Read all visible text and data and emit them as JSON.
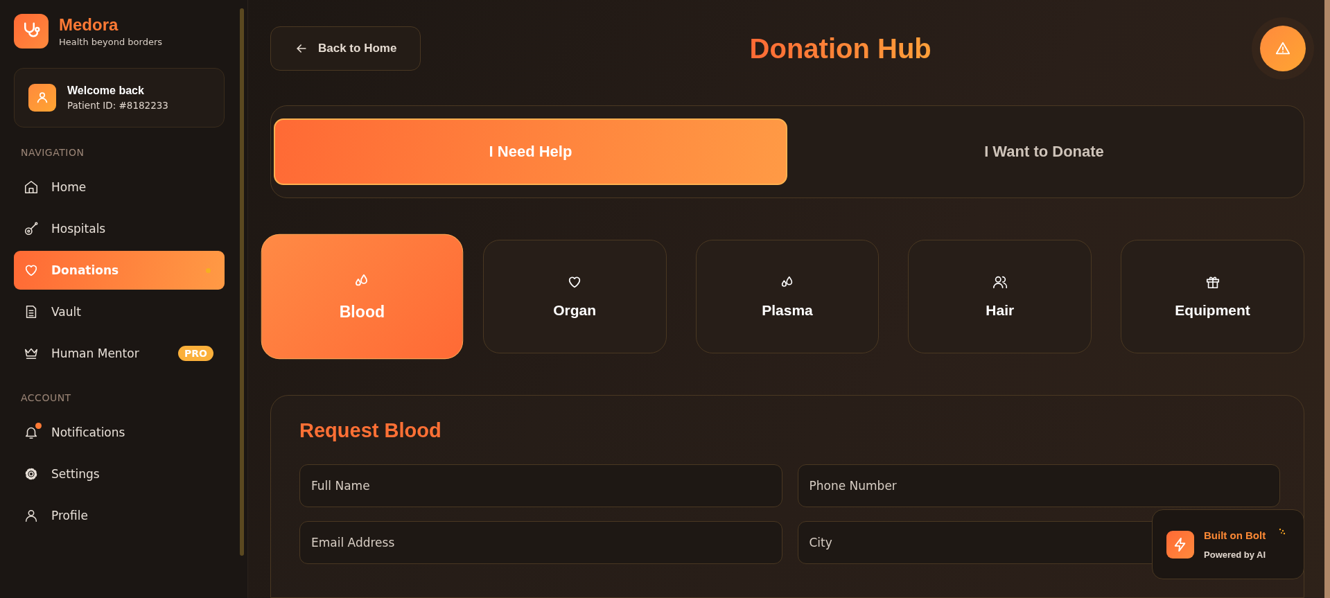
{
  "brand": {
    "name": "Medora",
    "tagline": "Health beyond borders"
  },
  "user": {
    "greeting": "Welcome back",
    "patient_id": "Patient ID: #8182233"
  },
  "sidebar": {
    "sections": [
      {
        "heading": "NAVIGATION",
        "items": [
          {
            "label": "Home",
            "kind": "home",
            "selected": false
          },
          {
            "label": "Hospitals",
            "kind": "guitar",
            "selected": false
          },
          {
            "label": "Donations",
            "kind": "heart",
            "selected": true
          },
          {
            "label": "Vault",
            "kind": "document",
            "selected": false
          },
          {
            "label": "Human Mentor",
            "kind": "crown",
            "selected": false,
            "badge": "PRO"
          }
        ]
      },
      {
        "heading": "ACCOUNT",
        "items": [
          {
            "label": "Notifications",
            "kind": "bell",
            "selected": false,
            "unread": true
          },
          {
            "label": "Settings",
            "kind": "gear",
            "selected": false
          },
          {
            "label": "Profile",
            "kind": "person",
            "selected": false
          }
        ]
      }
    ]
  },
  "header": {
    "back_button": "Back to Home",
    "title": "Donation Hub"
  },
  "mode_tabs": [
    {
      "label": "I Need Help",
      "selected": true
    },
    {
      "label": "I Want to Donate",
      "selected": false
    }
  ],
  "categories": [
    {
      "label": "Blood",
      "kind": "drops",
      "selected": true
    },
    {
      "label": "Organ",
      "kind": "heart",
      "selected": false
    },
    {
      "label": "Plasma",
      "kind": "drops",
      "selected": false
    },
    {
      "label": "Hair",
      "kind": "users",
      "selected": false
    },
    {
      "label": "Equipment",
      "kind": "gift",
      "selected": false
    }
  ],
  "form": {
    "title": "Request Blood",
    "fields": [
      {
        "placeholder": "Full Name"
      },
      {
        "placeholder": "Phone Number"
      },
      {
        "placeholder": "Email Address"
      },
      {
        "placeholder": "City"
      }
    ]
  },
  "bolt_badge": {
    "title": "Built on Bolt",
    "subtitle": "Powered by AI"
  }
}
